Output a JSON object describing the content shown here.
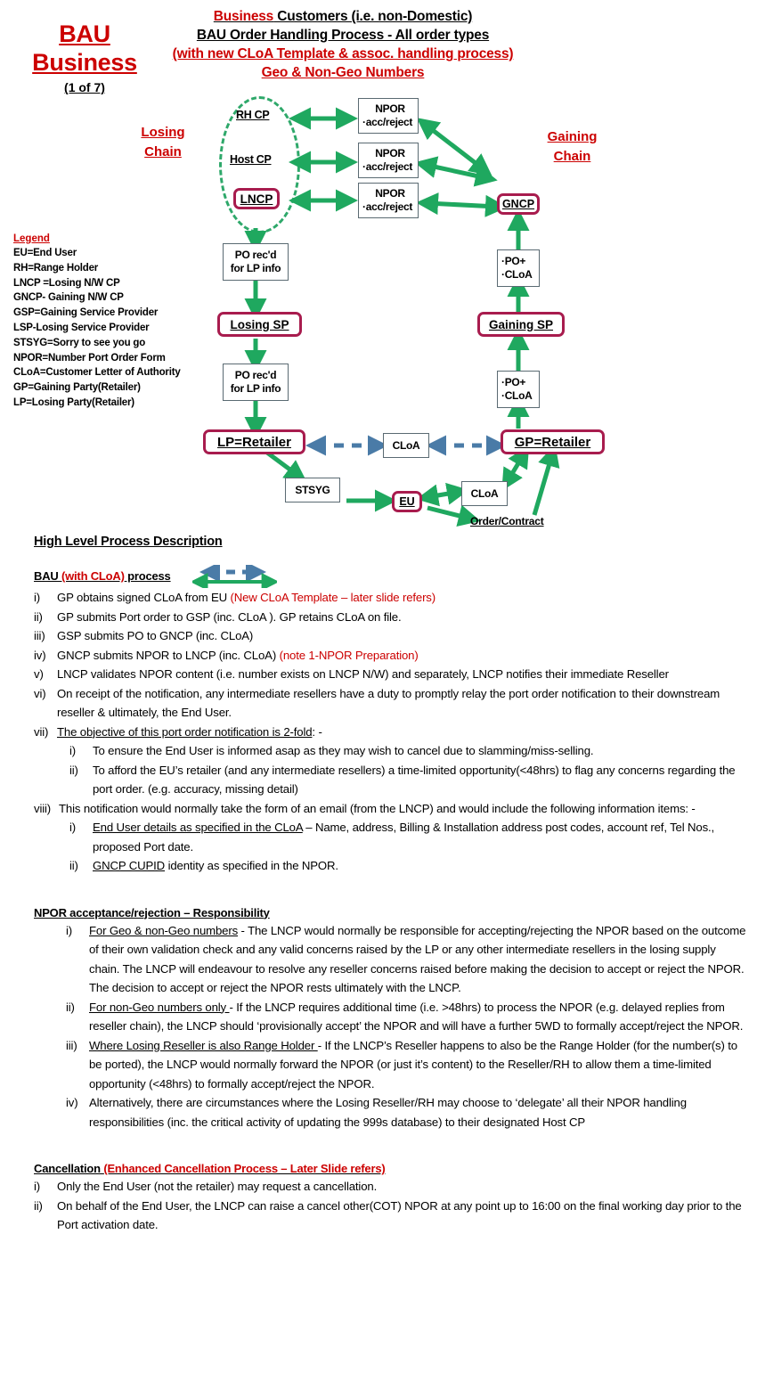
{
  "colors": {
    "red": "#CC0000",
    "green_arrow": "#1FA85F",
    "blue_arrow": "#4A7BA7",
    "magenta_border": "#A81C4E",
    "box_border": "#5A6A72"
  },
  "header": {
    "side_title_line1": "BAU",
    "side_title_line2": "Business",
    "side_title_line3": "(1 of 7)",
    "title_line1_red": "Business",
    "title_line1_rest": " Customers (i.e. non-Domestic)",
    "title_line2": "BAU Order Handling Process - All order types",
    "title_line3": "(with new CLoA Template & assoc. handling process)",
    "title_line4": "Geo & Non-Geo Numbers"
  },
  "legend": {
    "title": "Legend",
    "items": [
      "EU=End User",
      "RH=Range Holder",
      "LNCP =Losing N/W CP",
      "GNCP- Gaining N/W CP",
      "GSP=Gaining Service Provider",
      "LSP-Losing Service Provider",
      "STSYG=Sorry to see you go",
      "NPOR=Number Port Order Form",
      "CLoA=Customer Letter of Authority",
      "GP=Gaining Party(Retailer)",
      "LP=Losing Party(Retailer)"
    ]
  },
  "diagram": {
    "losing_chain_line1": "Losing",
    "losing_chain_line2": "Chain",
    "gaining_chain_line1": "Gaining",
    "gaining_chain_line2": "Chain",
    "rh_cp": "RH CP",
    "host_cp": "Host CP",
    "lncp": "LNCP",
    "gncp": "GNCP",
    "npor_title": "NPOR",
    "npor_sub": "·acc/reject",
    "po_recd_l1": "PO rec'd",
    "po_recd_l2": "for LP info",
    "losing_sp": "Losing SP",
    "gaining_sp": "Gaining SP",
    "po_cloa_l1": "·PO+",
    "po_cloa_l2": "·CLoA",
    "lp_retailer": "LP=Retailer",
    "gp_retailer": "GP=Retailer",
    "cloa": "CLoA",
    "stsyg": "STSYG",
    "eu": "EU",
    "order_contract": "Order/Contract"
  },
  "sections": {
    "high_level_heading": "High Level Process Description",
    "bau_heading_black1": "BAU ",
    "bau_heading_red": "(with CLoA)",
    "bau_heading_black2": " process",
    "bau_items": [
      {
        "mark": "i)",
        "text": "GP obtains signed CLoA from  EU ",
        "red": "(New CLoA Template – later slide refers)"
      },
      {
        "mark": "ii)",
        "text": "GP submits Port order to GSP (inc. CLoA ). GP retains CLoA on file.",
        "red": ""
      },
      {
        "mark": "iii)",
        "text": "GSP submits PO to GNCP (inc. CLoA)",
        "red": ""
      },
      {
        "mark": "iv)",
        "text": "GNCP submits NPOR to LNCP (inc. CLoA) ",
        "red": "(note 1-NPOR Preparation)"
      },
      {
        "mark": "v)",
        "text": "LNCP validates NPOR content (i.e. number exists on LNCP N/W) and separately, LNCP notifies their immediate Reseller",
        "red": ""
      },
      {
        "mark": "vi)",
        "text": "On receipt of the notification, any intermediate resellers have a duty to promptly relay the port order notification to their downstream reseller & ultimately, the End User.",
        "red": ""
      }
    ],
    "bau_item_vii_mark": "vii)",
    "bau_item_vii_underline": "The objective of this port order notification is 2-fold",
    "bau_item_vii_tail": ": -",
    "bau_vii_subs": [
      {
        "mark": "i)",
        "text": "To ensure the End User is informed asap as they may wish to cancel due to slamming/miss-selling."
      },
      {
        "mark": "ii)",
        "text": "To afford the EU’s retailer (and any intermediate resellers) a time-limited opportunity(<48hrs) to flag any concerns regarding the port order. (e.g. accuracy, missing detail)"
      }
    ],
    "bau_item_viii_mark": "viii)",
    "bau_item_viii_text": "This notification would normally take the form of an email (from the LNCP) and would include the following information items: -",
    "bau_viii_subs": [
      {
        "mark": "i)",
        "underline": " End User details as specified in the CLoA",
        "text": " – Name, address, Billing & Installation address post codes, account ref, Tel Nos., proposed Port date."
      },
      {
        "mark": "ii)",
        "underline": "GNCP CUPID",
        "text": " identity as specified in the NPOR."
      }
    ],
    "npor_heading": "NPOR acceptance/rejection – Responsibility",
    "npor_items": [
      {
        "mark": "i)",
        "underline": "For Geo & non-Geo numbers",
        "text": " - The LNCP would normally be responsible for accepting/rejecting the NPOR based on the outcome of their own validation check and any valid concerns raised by the LP or any other intermediate resellers in the losing supply chain. The LNCP will endeavour to resolve any reseller concerns raised before making the decision to accept or reject the NPOR. The decision to accept or reject the NPOR rests ultimately with the LNCP."
      },
      {
        "mark": "ii)",
        "underline": "For non-Geo numbers only ",
        "text": "- If the LNCP requires additional time (i.e. >48hrs) to process the NPOR (e.g. delayed replies from reseller chain), the LNCP should ‘provisionally accept’ the NPOR and will have a further 5WD to formally accept/reject the NPOR."
      },
      {
        "mark": "iii)",
        "underline": "Where Losing Reseller is also Range Holder ",
        "text": "- If the LNCP’s Reseller happens to also be the Range Holder (for the number(s) to be ported), the LNCP would normally forward the NPOR (or just it’s content) to the Reseller/RH to allow them a time-limited opportunity (<48hrs) to formally accept/reject the NPOR."
      },
      {
        "mark": "iv)",
        "underline": "",
        "text": "Alternatively, there are circumstances where the Losing Reseller/RH may choose to ‘delegate’ all their NPOR handling responsibilities (inc. the critical activity of updating the 999s database) to their designated Host CP"
      }
    ],
    "cancellation_heading_black": "Cancellation ",
    "cancellation_heading_red": "(Enhanced Cancellation Process – Later Slide refers)",
    "cancellation_items": [
      {
        "mark": "i)",
        "text": "Only the End User (not the retailer) may request a cancellation."
      },
      {
        "mark": "ii)",
        "text": "On behalf of the End User, the LNCP can raise a cancel other(COT) NPOR at any point up to 16:00 on the final working day prior to the Port activation date."
      }
    ]
  }
}
